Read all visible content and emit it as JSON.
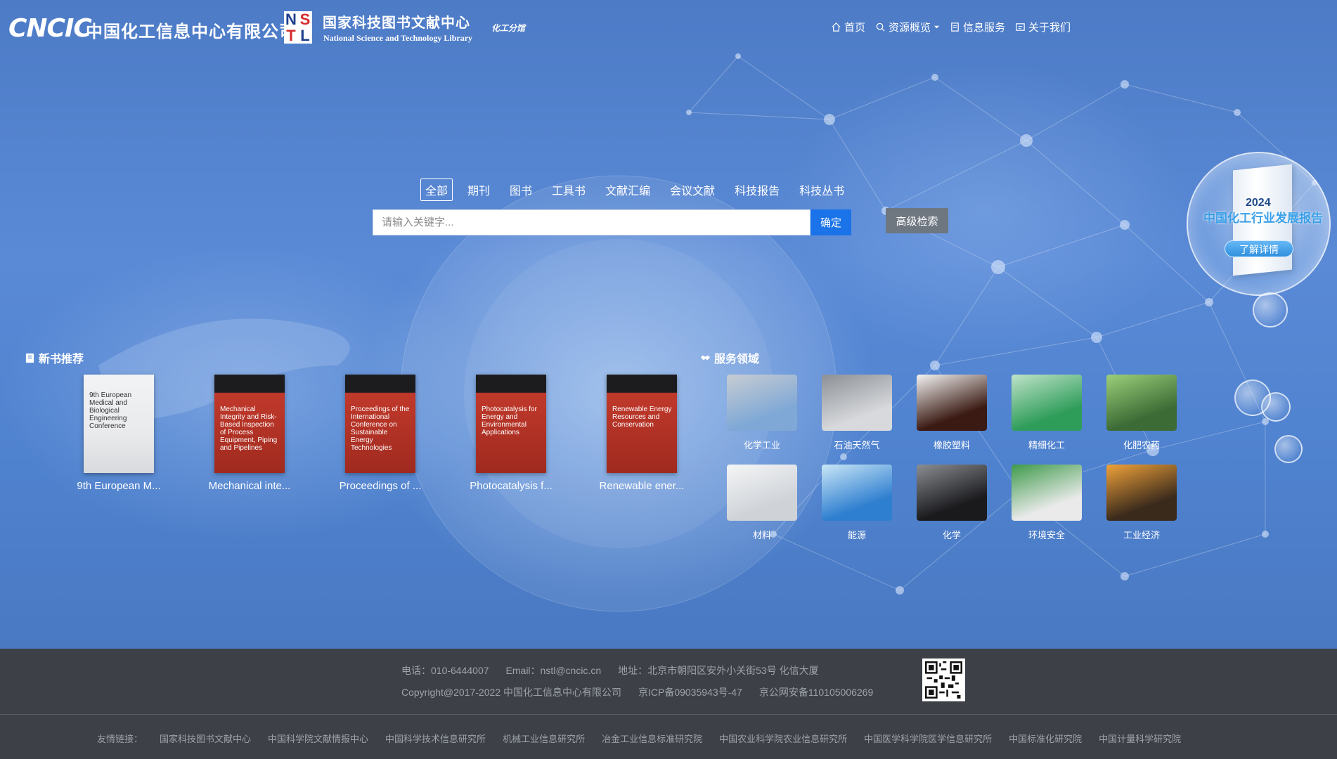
{
  "header": {
    "cncic_logo": "CNCIC",
    "cncic_name": "中国化工信息中心有限公司",
    "nstl_letters": [
      "N",
      "S",
      "T",
      "L"
    ],
    "nstl_name": "国家科技图书文献中心",
    "nstl_en": "National Science and Technology Library",
    "nstl_branch": "化工分馆",
    "nav": [
      {
        "label": "首页",
        "icon": "home-icon"
      },
      {
        "label": "资源概览",
        "icon": "search-icon",
        "dropdown": true
      },
      {
        "label": "信息服务",
        "icon": "document-icon"
      },
      {
        "label": "关于我们",
        "icon": "info-icon"
      }
    ]
  },
  "search": {
    "tabs": [
      "全部",
      "期刊",
      "图书",
      "工具书",
      "文献汇编",
      "会议文献",
      "科技报告",
      "科技丛书"
    ],
    "active_tab": "全部",
    "placeholder": "请输入关键字...",
    "value": "",
    "submit_label": "确定",
    "advanced_label": "高级检索"
  },
  "report": {
    "year": "2024",
    "title": "中国化工行业发展报告",
    "button": "了解详情"
  },
  "new_books": {
    "title": "新书推荐",
    "items": [
      {
        "label": "9th European M...",
        "cover_title": "9th European Medical and Biological Engineering Conference",
        "color": "#e9eaec"
      },
      {
        "label": "Mechanical inte...",
        "cover_title": "Mechanical Integrity and Risk-Based Inspection of Process Equipment, Piping and Pipelines",
        "color": "#c0392b"
      },
      {
        "label": "Proceedings of ...",
        "cover_title": "Proceedings of the International Conference on Sustainable Energy Technologies",
        "color": "#c0392b"
      },
      {
        "label": "Photocatalysis f...",
        "cover_title": "Photocatalysis for Energy and Environmental Applications",
        "color": "#c0392b"
      },
      {
        "label": "Renewable ener...",
        "cover_title": "Renewable Energy Resources and Conservation",
        "color": "#c0392b"
      }
    ]
  },
  "services": {
    "title": "服务领域",
    "items": [
      {
        "label": "化学工业",
        "colors": [
          "#7fa8d6",
          "#c7ccd2"
        ]
      },
      {
        "label": "石油天然气",
        "colors": [
          "#d7d9dc",
          "#8c9096"
        ]
      },
      {
        "label": "橡胶塑料",
        "colors": [
          "#3a1a12",
          "#f4f4f4"
        ]
      },
      {
        "label": "精细化工",
        "colors": [
          "#2f9d5a",
          "#bfe3c9"
        ]
      },
      {
        "label": "化肥农药",
        "colors": [
          "#3d6b35",
          "#9ccf7a"
        ]
      },
      {
        "label": "材料",
        "colors": [
          "#cfd3d8",
          "#f4f5f6"
        ]
      },
      {
        "label": "能源",
        "colors": [
          "#2f7fd0",
          "#c9e6f7"
        ]
      },
      {
        "label": "化学",
        "colors": [
          "#1a1a1d",
          "#8a8d92"
        ]
      },
      {
        "label": "环境安全",
        "colors": [
          "#eaeaea",
          "#3d9a4a"
        ]
      },
      {
        "label": "工业经济",
        "colors": [
          "#3a2a1c",
          "#f0a23a"
        ]
      }
    ]
  },
  "footer": {
    "phone": "电话：010-6444007",
    "email": "Email：nstl@cncic.cn",
    "address": "地址：北京市朝阳区安外小关街53号 化信大厦",
    "copyright": "Copyright@2017-2022 中国化工信息中心有限公司",
    "icp": "京ICP备09035943号-47",
    "police": "京公网安备110105006269",
    "friend_label": "友情链接：",
    "friend_links": [
      "国家科技图书文献中心",
      "中国科学院文献情报中心",
      "中国科学技术信息研究所",
      "机械工业信息研究所",
      "冶金工业信息标准研究院",
      "中国农业科学院农业信息研究所",
      "中国医学科学院医学信息研究所",
      "中国标准化研究院",
      "中国计量科学研究院"
    ]
  }
}
